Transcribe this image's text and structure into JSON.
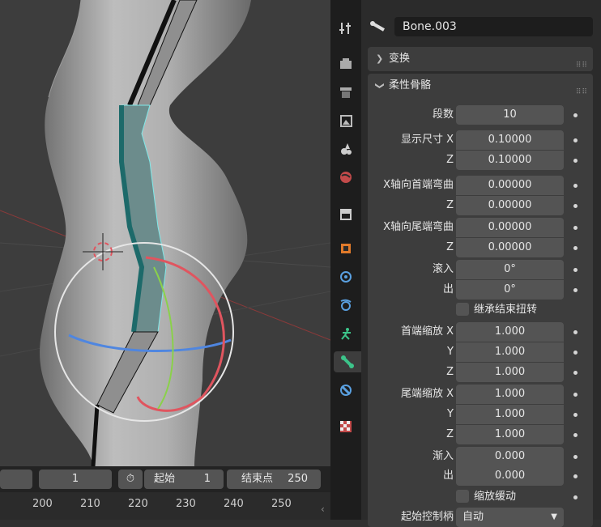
{
  "viewport": {},
  "timeline": {
    "current_frame": "1",
    "start_label": "起始",
    "start_value": "1",
    "end_label": "结束点",
    "end_value": "250",
    "ruler": [
      "200",
      "210",
      "220",
      "230",
      "240",
      "250"
    ]
  },
  "properties": {
    "bone_name": "Bone.003",
    "transform_label": "变换",
    "bbone_label": "柔性骨骼",
    "segments_label": "段数",
    "segments_value": "10",
    "display_size_label": "显示尺寸 X",
    "display_x": "0.10000",
    "z_label": "Z",
    "display_z": "0.10000",
    "curve_in_label": "X轴向首端弯曲",
    "curve_in_x": "0.00000",
    "curve_in_z": "0.00000",
    "curve_out_label": "X轴向尾端弯曲",
    "curve_out_x": "0.00000",
    "curve_out_z": "0.00000",
    "roll_in_label": "滚入",
    "roll_in_value": "0°",
    "roll_out_label": "出",
    "roll_out_value": "0°",
    "inherit_roll_label": "继承结束扭转",
    "scale_in_label": "首端缩放 X",
    "scale_in_x": "1.000",
    "y_label": "Y",
    "scale_in_y": "1.000",
    "scale_in_z": "1.000",
    "scale_out_label": "尾端缩放 X",
    "scale_out_x": "1.000",
    "scale_out_y": "1.000",
    "scale_out_z": "1.000",
    "ease_in_label": "渐入",
    "ease_in_value": "0.000",
    "ease_out_label": "出",
    "ease_out_value": "0.000",
    "scale_easing_label": "缩放缓动",
    "start_handle_label": "起始控制柄",
    "start_handle_value": "自动"
  },
  "colors": {
    "accent": "#4772b3",
    "bone_active": "#2c8a8a",
    "x_axis": "#e0555f",
    "y_axis": "#8ad14a",
    "z_axis": "#4f86e0"
  }
}
